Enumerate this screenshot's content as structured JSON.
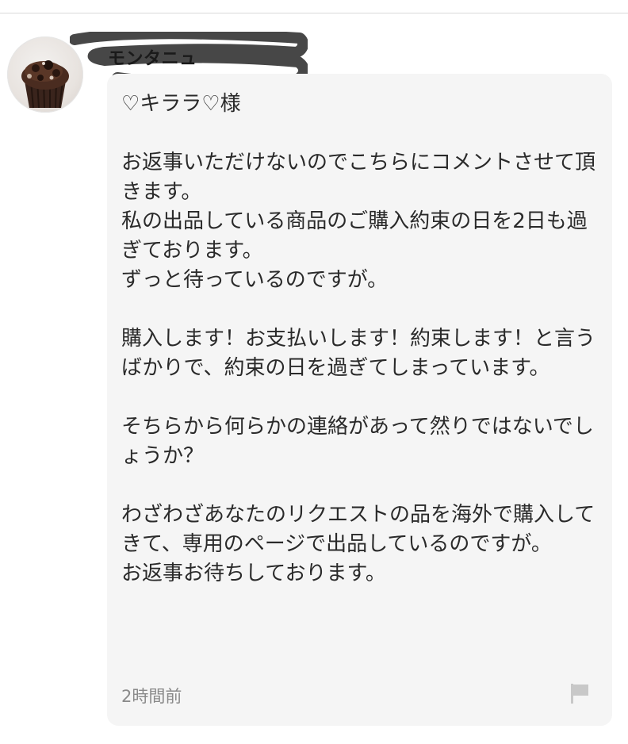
{
  "comment": {
    "username": "モンタニュ",
    "message": "♡キララ♡様\n\nお返事いただけないのでこちらにコメントさせて頂きます。\n私の出品している商品のご購入約束の日を2日も過ぎております。\nずっと待っているのですが。\n\n購入します！お支払いします！約束します！と言うばかりで、約束の日を過ぎてしまっています。\n\nそちらから何らかの連絡があって然りではないでしょうか？\n\nわざわざあなたのリクエストの品を海外で購入してきて、専用のページで出品しているのですが。\nお返事お待ちしております。",
    "timestamp": "2時間前",
    "icons": {
      "avatar": "chocolate-cupcake-photo",
      "report": "flag-icon"
    }
  },
  "colors": {
    "bubble_background": "#f5f5f5",
    "text": "#2a2a2a",
    "timestamp": "#8a8a8a",
    "name_redaction": "#3a3a3a",
    "flag": "#c8c8c8"
  }
}
